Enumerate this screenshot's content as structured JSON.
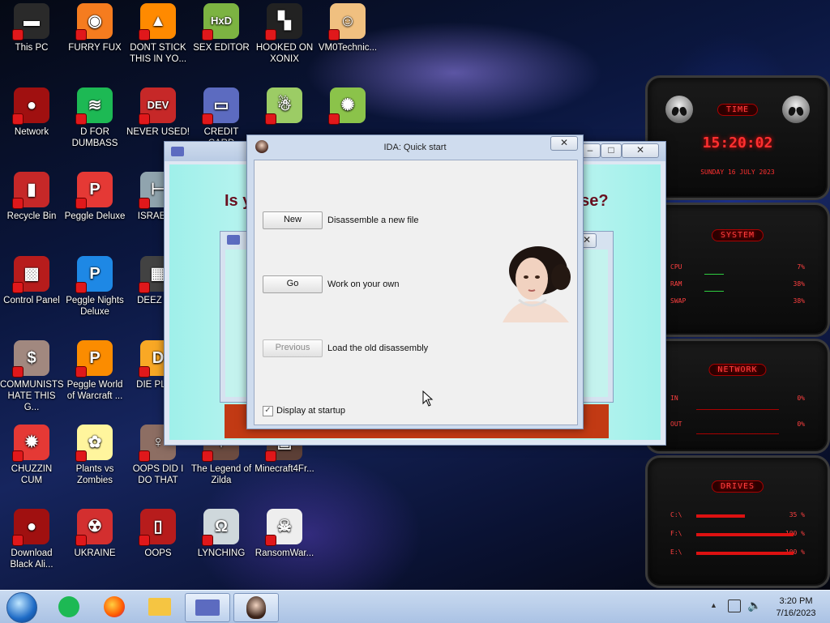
{
  "desktop": {
    "icons": [
      {
        "label": "This PC",
        "icon": "computer-icon",
        "color": "#2a2a2a",
        "glyph": "▬"
      },
      {
        "label": "FURRY FUX",
        "icon": "firefox-icon",
        "color": "#f57c1f",
        "glyph": "◉"
      },
      {
        "label": "DONT STICK THIS IN YO...",
        "icon": "vlc-cone-icon",
        "color": "#ff8a00",
        "glyph": "▲"
      },
      {
        "label": "SEX EDITOR",
        "icon": "hex-editor-icon",
        "color": "#7cb342",
        "glyph": "HxD"
      },
      {
        "label": "HOOKED ON XONIX",
        "icon": "xonix-game-icon",
        "color": "#222222",
        "glyph": "▚"
      },
      {
        "label": "VM0Technic...",
        "icon": "doctor-avatar-icon",
        "color": "#f0c080",
        "glyph": "☺"
      },
      {
        "label": "Network",
        "icon": "alienware-network-icon",
        "color": "#a01010",
        "glyph": "●"
      },
      {
        "label": "D FOR DUMBASS",
        "icon": "spotify-icon",
        "color": "#1db954",
        "glyph": "≋"
      },
      {
        "label": "NEVER USED!",
        "icon": "devcpp-icon",
        "color": "#c62828",
        "glyph": "DEV"
      },
      {
        "label": "CREDIT CARD",
        "icon": "credit-card-icon",
        "color": "#5c6bc0",
        "glyph": "▭"
      },
      {
        "label": "",
        "icon": "santa-icon",
        "color": "#9ccc65",
        "glyph": "☃"
      },
      {
        "label": "",
        "icon": "lime-icon",
        "color": "#8bc34a",
        "glyph": "✺"
      },
      {
        "label": "Recycle Bin",
        "icon": "recycle-bin-icon",
        "color": "#c62828",
        "glyph": "▮"
      },
      {
        "label": "Peggle Deluxe",
        "icon": "peggle-icon",
        "color": "#e53935",
        "glyph": "P"
      },
      {
        "label": "ISRAEL...",
        "icon": "pipe-icon",
        "color": "#90a4ae",
        "glyph": "⊢"
      },
      {
        "label": "Control Panel",
        "icon": "control-panel-icon",
        "color": "#b71c1c",
        "glyph": "▩"
      },
      {
        "label": "Peggle Nights Deluxe",
        "icon": "peggle-nights-icon",
        "color": "#1e88e5",
        "glyph": "P"
      },
      {
        "label": "DEEZ N...",
        "icon": "windows-icon",
        "color": "#424242",
        "glyph": "▦"
      },
      {
        "label": "COMMUNISTS HATE THIS G...",
        "icon": "money-bag-icon",
        "color": "#a1887f",
        "glyph": "$"
      },
      {
        "label": "Peggle World of Warcraft ...",
        "icon": "peggle-wow-icon",
        "color": "#fb8c00",
        "glyph": "P"
      },
      {
        "label": "DIE PLE...",
        "icon": "dolby-icon",
        "color": "#f9a825",
        "glyph": "D"
      },
      {
        "label": "CHUZZIN CUM",
        "icon": "chuzzle-icon",
        "color": "#e53935",
        "glyph": "✹"
      },
      {
        "label": "Plants vs Zombies",
        "icon": "pvz-flower-icon",
        "color": "#fff59d",
        "glyph": "✿"
      },
      {
        "label": "OOPS DID I DO THAT",
        "icon": "portrait-icon",
        "color": "#8d6e63",
        "glyph": "♀"
      },
      {
        "label": "The Legend of Zilda",
        "icon": "zelda-icon",
        "color": "#6d4c41",
        "glyph": "✦"
      },
      {
        "label": "Minecraft4Fr...",
        "icon": "minecraft-icon",
        "color": "#5d4037",
        "glyph": "▣"
      },
      {
        "label": "Download Black Ali...",
        "icon": "alienware-download-icon",
        "color": "#a01010",
        "glyph": "●"
      },
      {
        "label": "UKRAINE",
        "icon": "radiation-icon",
        "color": "#d32f2f",
        "glyph": "☢"
      },
      {
        "label": "OOPS",
        "icon": "portrait-frame-icon",
        "color": "#b71c1c",
        "glyph": "▯"
      },
      {
        "label": "LYNCHING",
        "icon": "noose-icon",
        "color": "#cfd8dc",
        "glyph": "Ω"
      },
      {
        "label": "RansomWar...",
        "icon": "skull-icon",
        "color": "#eeeeee",
        "glyph": "☠"
      }
    ]
  },
  "widgets": {
    "time": {
      "title": "TIME",
      "clock": "15:20:02",
      "date": "SUNDAY 16 JULY 2023"
    },
    "system": {
      "title": "SYSTEM",
      "rows": [
        {
          "label": "CPU",
          "value": "7%"
        },
        {
          "label": "RAM",
          "value": "38%"
        },
        {
          "label": "SWAP",
          "value": "38%"
        }
      ]
    },
    "network": {
      "title": "NETWORK",
      "rows": [
        {
          "label": "IN",
          "value": "0%"
        },
        {
          "label": "OUT",
          "value": "0%"
        }
      ]
    },
    "drives": {
      "title": "DRIVES",
      "rows": [
        {
          "label": "C:\\",
          "value": "35 %"
        },
        {
          "label": "F:\\",
          "value": "100 %"
        },
        {
          "label": "E:\\",
          "value": "100 %"
        }
      ]
    }
  },
  "bg_window": {
    "question_left": "Is y",
    "question_right": "ase?"
  },
  "dialog": {
    "title": "IDA: Quick start",
    "close_glyph": "✕",
    "buttons": [
      {
        "label": "New",
        "desc": "Disassemble a new file",
        "enabled": true
      },
      {
        "label": "Go",
        "desc": "Work on your own",
        "enabled": true
      },
      {
        "label": "Previous",
        "desc": "Load the old disassembly",
        "enabled": false
      }
    ],
    "checkbox_label": "Display at startup",
    "checkbox_checked": true
  },
  "taskbar": {
    "clock_time": "3:20 PM",
    "clock_date": "7/16/2023",
    "items": [
      "spotify-icon",
      "firefox-icon",
      "file-explorer-icon",
      "credit-card-app-icon",
      "ida-portrait-icon"
    ]
  },
  "colors": {
    "dialog_bg": "#f0f0f0",
    "bg_window_teal": "#bff5ef",
    "red_accent": "#ff3030",
    "taskbar": "#b9cfec"
  }
}
